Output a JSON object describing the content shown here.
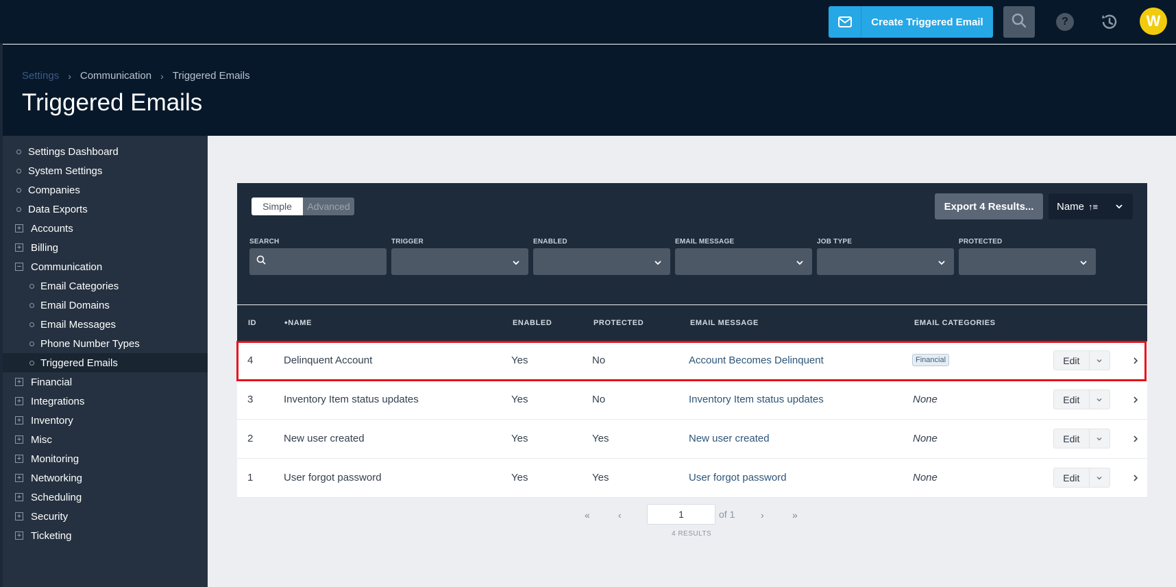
{
  "topbar": {
    "create_label": "Create Triggered Email",
    "help_glyph": "?",
    "avatar_initial": "W",
    "icons": [
      "mail-icon",
      "search-icon",
      "help-icon",
      "history-icon"
    ]
  },
  "breadcrumb": {
    "items": [
      "Settings",
      "Communication",
      "Triggered Emails"
    ],
    "separator": "›"
  },
  "page_title": "Triggered Emails",
  "sidebar": {
    "items": [
      {
        "label": "Settings Dashboard",
        "kind": "bullet"
      },
      {
        "label": "System Settings",
        "kind": "bullet"
      },
      {
        "label": "Companies",
        "kind": "bullet"
      },
      {
        "label": "Data Exports",
        "kind": "bullet"
      },
      {
        "label": "Accounts",
        "kind": "plus"
      },
      {
        "label": "Billing",
        "kind": "plus"
      },
      {
        "label": "Communication",
        "kind": "minus"
      },
      {
        "label": "Email Categories",
        "kind": "sub"
      },
      {
        "label": "Email Domains",
        "kind": "sub"
      },
      {
        "label": "Email Messages",
        "kind": "sub"
      },
      {
        "label": "Phone Number Types",
        "kind": "sub"
      },
      {
        "label": "Triggered Emails",
        "kind": "sub",
        "active": true
      },
      {
        "label": "Financial",
        "kind": "plus"
      },
      {
        "label": "Integrations",
        "kind": "plus"
      },
      {
        "label": "Inventory",
        "kind": "plus"
      },
      {
        "label": "Misc",
        "kind": "plus"
      },
      {
        "label": "Monitoring",
        "kind": "plus"
      },
      {
        "label": "Networking",
        "kind": "plus"
      },
      {
        "label": "Scheduling",
        "kind": "plus"
      },
      {
        "label": "Security",
        "kind": "plus"
      },
      {
        "label": "Ticketing",
        "kind": "plus"
      }
    ]
  },
  "panel": {
    "toggle": {
      "simple": "Simple",
      "advanced": "Advanced",
      "selected": "Simple"
    },
    "export_label": "Export 4 Results...",
    "sort_label": "Name",
    "sort_glyph": "↑≡",
    "filters": {
      "search": {
        "label": "SEARCH",
        "value": ""
      },
      "trigger": {
        "label": "TRIGGER",
        "value": ""
      },
      "enabled": {
        "label": "ENABLED",
        "value": ""
      },
      "email_message": {
        "label": "EMAIL MESSAGE",
        "value": ""
      },
      "job_type": {
        "label": "JOB TYPE",
        "value": ""
      },
      "protected": {
        "label": "PROTECTED",
        "value": ""
      }
    }
  },
  "table": {
    "columns": {
      "id": "ID",
      "name": "NAME",
      "enabled": "ENABLED",
      "protected": "PROTECTED",
      "email_message": "EMAIL MESSAGE",
      "email_categories": "EMAIL CATEGORIES"
    },
    "edit_label": "Edit",
    "rows": [
      {
        "id": "4",
        "name": "Delinquent Account",
        "enabled": "Yes",
        "protected": "No",
        "email_message": "Account Becomes Delinquent",
        "category": "Financial",
        "category_is_badge": true
      },
      {
        "id": "3",
        "name": "Inventory Item status updates",
        "enabled": "Yes",
        "protected": "No",
        "email_message": "Inventory Item status updates",
        "category": "None",
        "category_is_badge": false
      },
      {
        "id": "2",
        "name": "New user created",
        "enabled": "Yes",
        "protected": "Yes",
        "email_message": "New user created",
        "category": "None",
        "category_is_badge": false
      },
      {
        "id": "1",
        "name": "User forgot password",
        "enabled": "Yes",
        "protected": "Yes",
        "email_message": "User forgot password",
        "category": "None",
        "category_is_badge": false
      }
    ]
  },
  "pagination": {
    "first": "«",
    "prev": "‹",
    "page": "1",
    "of_label": "of 1",
    "next": "›",
    "last": "»",
    "results": "4 RESULTS"
  },
  "colors": {
    "accent": "#26a7e6",
    "nav_bg": "#07182a",
    "sidebar_bg": "#253140",
    "highlight": "#e8101a",
    "avatar": "#f2cc0c"
  }
}
